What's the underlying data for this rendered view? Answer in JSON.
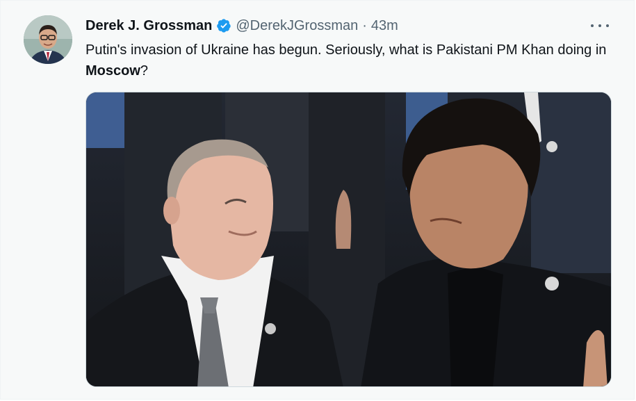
{
  "tweet": {
    "author_name": "Derek J. Grossman",
    "handle": "@DerekJGrossman",
    "separator": "·",
    "time": "43m",
    "text_before": "Putin's invasion of Ukraine has begun. Seriously, what is Pakistani PM Khan doing in ",
    "text_bold": "Moscow",
    "text_after": "?",
    "verified": true
  },
  "icons": {
    "verified": "verified-badge-icon",
    "more": "more-options-icon",
    "avatar": "avatar"
  },
  "colors": {
    "accent": "#1d9bf0",
    "secondary_text": "#536471",
    "primary_text": "#0f1419"
  }
}
